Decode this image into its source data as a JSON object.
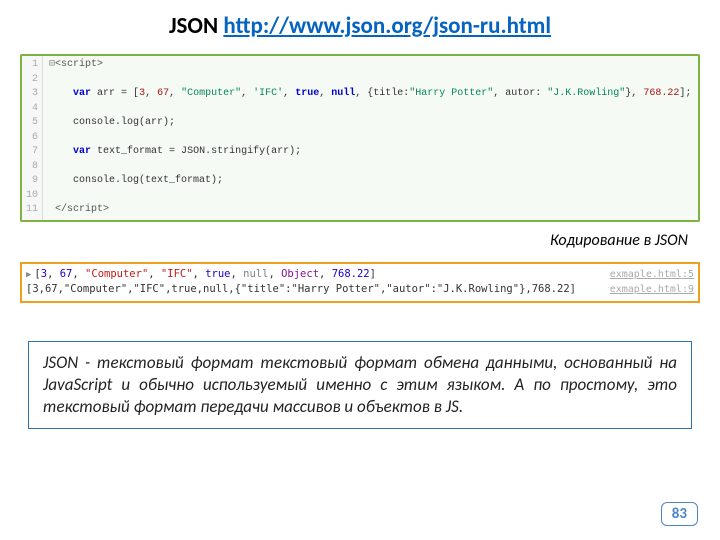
{
  "title_prefix": "JSON ",
  "title_link": "http://www.json.org/json-ru.html",
  "code_lines": [
    "1",
    "2",
    "3",
    "4",
    "5",
    "6",
    "7",
    "8",
    "9",
    "10",
    "11"
  ],
  "code": {
    "l1a": "<script>",
    "l3_var": "var",
    "l3_a": " arr = [",
    "l3_n1": "3",
    "l3_s1": ", ",
    "l3_n2": "67",
    "l3_s2": ", ",
    "l3_str1": "\"Computer\"",
    "l3_s3": ", ",
    "l3_str2": "'IFC'",
    "l3_s4": ", ",
    "l3_true": "true",
    "l3_s5": ", ",
    "l3_null": "null",
    "l3_s6": ", {title:",
    "l3_str3": "\"Harry Potter\"",
    "l3_s7": ", autor: ",
    "l3_str4": "\"J.K.Rowling\"",
    "l3_s8": "}, ",
    "l3_n3": "768.22",
    "l3_s9": "];",
    "l5": "console.log(arr);",
    "l7_var": "var",
    "l7": " text_format = JSON.stringify(arr);",
    "l9": "console.log(text_format);",
    "l11": "</script>"
  },
  "caption": "Кодирование в JSON",
  "console": {
    "line1_parts": [
      "[",
      "3",
      ", ",
      "67",
      ", ",
      "\"Computer\"",
      ", ",
      "\"IFC\"",
      ", ",
      "true",
      ", ",
      "null",
      ", ",
      "Object",
      ", ",
      "768.22",
      "]"
    ],
    "line1_src": "exmaple.html:5",
    "line2": "[3,67,\"Computer\",\"IFC\",true,null,{\"title\":\"Harry Potter\",\"autor\":\"J.K.Rowling\"},768.22]",
    "line2_src": "exmaple.html:9"
  },
  "definition": "JSON - текстовый формат текстовый формат обмена данными, основанный на JavaScript и обычно используемый именно с этим языком. А по простому, это текстовый формат передачи массивов и объектов в JS.",
  "page_number": "83"
}
